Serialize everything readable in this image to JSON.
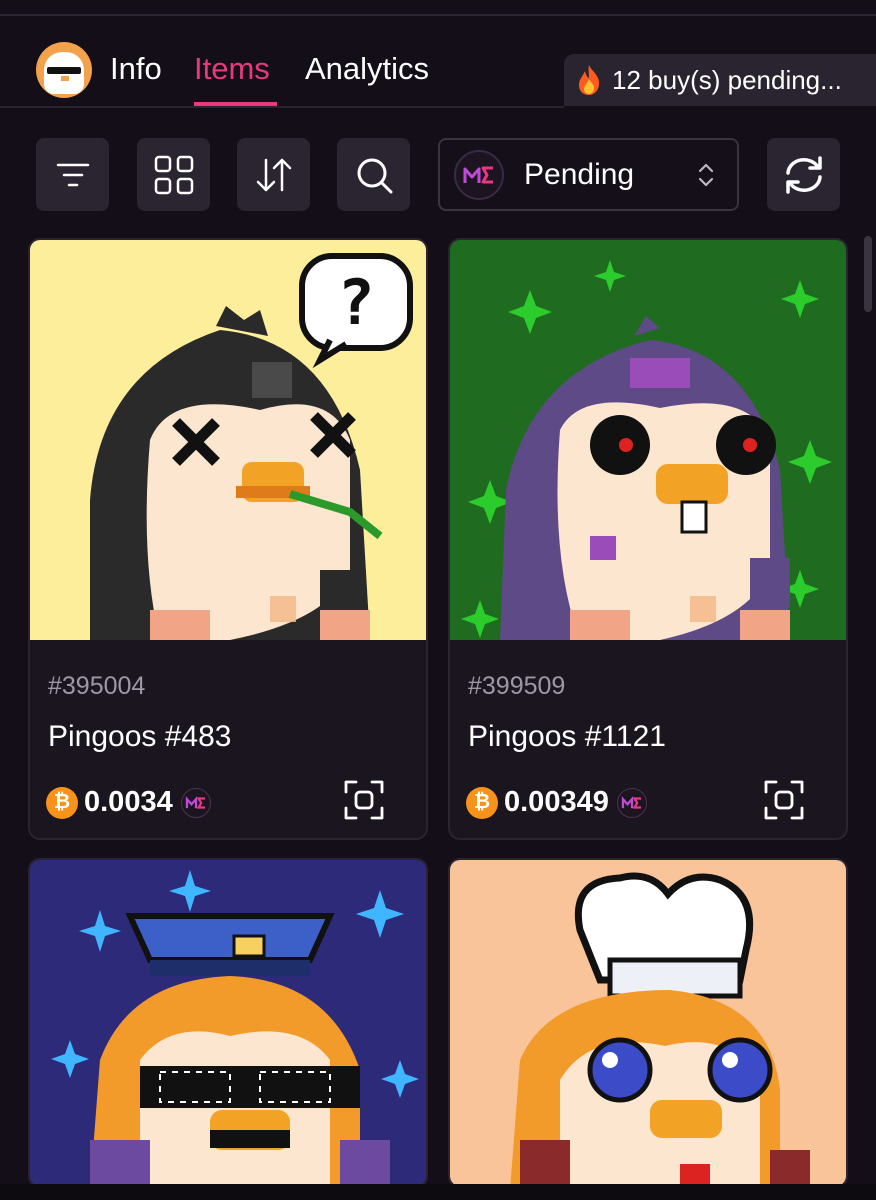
{
  "header": {
    "tabs": [
      {
        "label": "Info",
        "active": false
      },
      {
        "label": "Items",
        "active": true
      },
      {
        "label": "Analytics",
        "active": false
      }
    ],
    "pending": {
      "icon": "fire-icon",
      "text": "12 buy(s) pending..."
    }
  },
  "toolbar": {
    "buttons": [
      "filter-icon",
      "grid-view-icon",
      "sort-icon",
      "search-icon"
    ],
    "select": {
      "label": "Pending",
      "icon": "magic-eden-logo"
    },
    "refresh": "refresh-icon"
  },
  "items": [
    {
      "inscription": "#395004",
      "name": "Pingoos #483",
      "price": "0.0034",
      "currency_icon": "bitcoin-icon",
      "bg": "#fdee9b"
    },
    {
      "inscription": "#399509",
      "name": "Pingoos #1121",
      "price": "0.00349",
      "currency_icon": "bitcoin-icon",
      "bg": "#1f6b1f"
    },
    {
      "bg": "#2e2a7a"
    },
    {
      "bg": "#f9c49a"
    }
  ],
  "colors": {
    "accent": "#e8397f",
    "background": "#130e18",
    "card": "#1b1520",
    "bitcoin": "#f7931a"
  }
}
